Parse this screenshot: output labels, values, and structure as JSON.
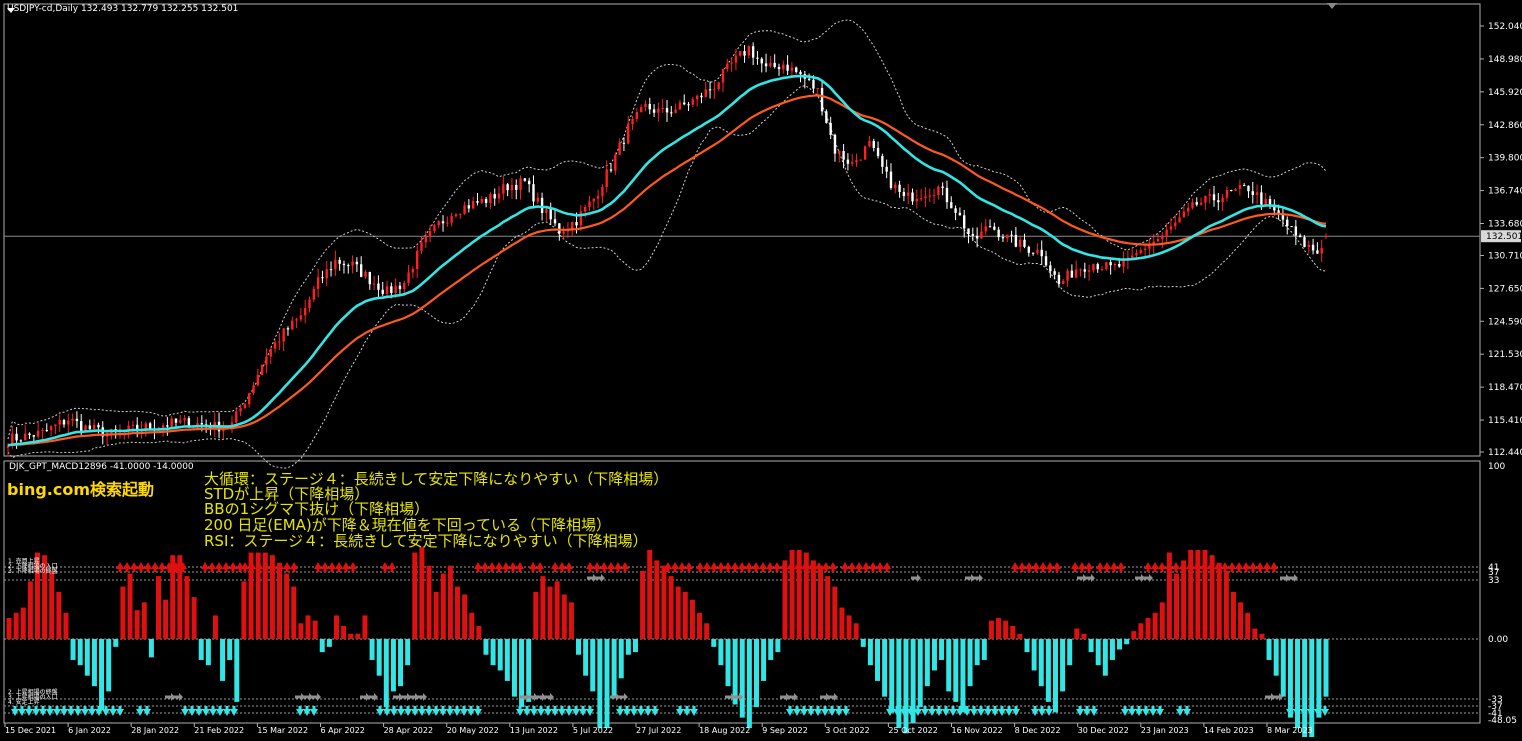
{
  "header": {
    "symbol_line": "USDJPY-cd,Daily  132.493 132.779 132.255 132.501",
    "indicator_line": "DJK_GPT_MACD12896 -41.0000 -14.0000"
  },
  "overlay": {
    "bing_label": "bing.com検索起動",
    "signals": [
      "大循環：ステージ４：長続きして安定下降になりやすい（下降相場）",
      "STDが上昇（下降相場）",
      "BBの1シグマ下抜け（下降相場）",
      "200 日足(EMA)が下降＆現在値を下回っている（下降相場）",
      "RSI：ステージ４：長続きして安定下降になりやすい（下降相場）"
    ],
    "upper_legend": [
      "1. 売買上昇",
      "2. 下降相場の入口",
      "3. 下降相場の終盤"
    ],
    "lower_legend": [
      "2. 上昇相場の終盤",
      "3. 上昇相場の入口",
      "4. 安定上昇"
    ]
  },
  "colors": {
    "background": "#000000",
    "bull_candle": "#ff2020",
    "bear_candle": "#ffffff",
    "ema_fast": "#33e6e6",
    "ema_slow": "#ff5a1e",
    "bollinger": "#d0d0d0",
    "hist_up": "#e01010",
    "hist_down": "#33e6e6",
    "arrow_up": "#e01010",
    "arrow_gray": "#909090",
    "axis_text": "#ffffff",
    "signal_text": "#e6e600",
    "bing_text": "#ffd800",
    "current_price_line": "#8a8a8a"
  },
  "chart_data": [
    {
      "type": "candlestick",
      "title": "USDJPY-cd,Daily",
      "last_ohlc": {
        "open": 132.493,
        "high": 132.779,
        "low": 132.255,
        "close": 132.501
      },
      "current_price": 132.501,
      "ylim": [
        112.44,
        152.04
      ],
      "y_ticks": [
        152.04,
        148.98,
        145.92,
        142.86,
        139.8,
        136.74,
        133.68,
        130.71,
        127.65,
        124.59,
        121.53,
        118.47,
        115.41,
        112.44
      ],
      "x_tick_labels": [
        "15 Dec 2021",
        "6 Jan 2022",
        "28 Jan 2022",
        "21 Feb 2022",
        "15 Mar 2022",
        "6 Apr 2022",
        "28 Apr 2022",
        "20 May 2022",
        "13 Jun 2022",
        "5 Jul 2022",
        "27 Jul 2022",
        "18 Aug 2022",
        "9 Sep 2022",
        "3 Oct 2022",
        "25 Oct 2022",
        "16 Nov 2022",
        "8 Dec 2022",
        "30 Dec 2022",
        "23 Jan 2023",
        "14 Feb 2023",
        "8 Mar 2023"
      ],
      "close_path": [
        [
          0,
          113.6
        ],
        [
          8,
          114.2
        ],
        [
          14,
          115.5
        ],
        [
          18,
          114.7
        ],
        [
          24,
          114.1
        ],
        [
          30,
          114.6
        ],
        [
          36,
          115.0
        ],
        [
          42,
          115.2
        ],
        [
          48,
          114.8
        ],
        [
          52,
          115.0
        ],
        [
          56,
          118.0
        ],
        [
          60,
          121.5
        ],
        [
          64,
          123.5
        ],
        [
          68,
          125.0
        ],
        [
          72,
          128.2
        ],
        [
          76,
          130.2
        ],
        [
          80,
          129.8
        ],
        [
          84,
          128.5
        ],
        [
          88,
          127.3
        ],
        [
          92,
          128.2
        ],
        [
          96,
          131.5
        ],
        [
          100,
          133.6
        ],
        [
          104,
          135.0
        ],
        [
          108,
          135.5
        ],
        [
          112,
          136.0
        ],
        [
          116,
          137.2
        ],
        [
          120,
          137.5
        ],
        [
          124,
          135.0
        ],
        [
          128,
          133.0
        ],
        [
          132,
          134.0
        ],
        [
          136,
          136.0
        ],
        [
          140,
          139.0
        ],
        [
          144,
          142.5
        ],
        [
          148,
          144.5
        ],
        [
          152,
          144.0
        ],
        [
          156,
          144.5
        ],
        [
          160,
          145.3
        ],
        [
          164,
          146.5
        ],
        [
          168,
          148.5
        ],
        [
          172,
          150.0
        ],
        [
          176,
          148.0
        ],
        [
          180,
          148.5
        ],
        [
          184,
          147.5
        ],
        [
          188,
          146.0
        ],
        [
          192,
          140.5
        ],
        [
          196,
          139.2
        ],
        [
          200,
          141.0
        ],
        [
          204,
          138.0
        ],
        [
          208,
          136.0
        ],
        [
          212,
          136.5
        ],
        [
          216,
          137.0
        ],
        [
          220,
          135.0
        ],
        [
          224,
          132.0
        ],
        [
          228,
          133.5
        ],
        [
          232,
          132.3
        ],
        [
          236,
          131.5
        ],
        [
          240,
          131.0
        ],
        [
          244,
          128.0
        ],
        [
          248,
          129.5
        ],
        [
          252,
          130.0
        ],
        [
          256,
          129.5
        ],
        [
          260,
          130.0
        ],
        [
          264,
          131.5
        ],
        [
          268,
          132.5
        ],
        [
          272,
          134.0
        ],
        [
          276,
          135.5
        ],
        [
          280,
          136.0
        ],
        [
          284,
          136.5
        ],
        [
          288,
          137.0
        ],
        [
          292,
          135.5
        ],
        [
          296,
          134.0
        ],
        [
          300,
          132.0
        ],
        [
          304,
          131.0
        ],
        [
          306,
          132.5
        ]
      ],
      "series": [
        {
          "name": "",
          "kind": "ema_fast",
          "period": 25
        },
        {
          "name": "",
          "kind": "ema_slow",
          "period": 45
        },
        {
          "name": "",
          "kind": "bollinger",
          "period": 20,
          "sigma": 2
        }
      ]
    },
    {
      "type": "bar",
      "title": "DJK_GPT_MACD12896",
      "ylim": [
        -48.05,
        100
      ],
      "y_ticks": [
        100,
        41,
        37,
        33,
        0.0,
        -33,
        -37,
        -41,
        -48.05
      ],
      "y_tick_labels": [
        "100",
        "41",
        "37",
        "33",
        "0.00",
        "-33",
        "-37",
        "-41",
        "-48.05"
      ],
      "values": [
        8,
        10,
        12,
        22,
        33,
        32,
        26,
        18,
        10,
        -8,
        -10,
        -14,
        -18,
        -27,
        -20,
        -3,
        20,
        25,
        11,
        14,
        -7,
        24,
        15,
        32,
        32,
        24,
        16,
        -8,
        -10,
        9,
        -16,
        -8,
        -24,
        22,
        33,
        33,
        33,
        32,
        29,
        25,
        20,
        6,
        9,
        7,
        -5,
        -3,
        9,
        5,
        2,
        2,
        9,
        -8,
        -14,
        -26,
        -20,
        -18,
        -10,
        33,
        35,
        28,
        18,
        25,
        28,
        20,
        17,
        10,
        5,
        -6,
        -10,
        -12,
        -16,
        -22,
        -26,
        -24,
        18,
        24,
        20,
        22,
        17,
        14,
        -6,
        -14,
        -20,
        -34,
        -34,
        -22,
        -15,
        -6,
        -5,
        26,
        34,
        30,
        28,
        24,
        20,
        18,
        15,
        10,
        6,
        -3,
        -10,
        -18,
        -25,
        -30,
        -34,
        -26,
        -16,
        -8,
        -5,
        30,
        34,
        34,
        33,
        30,
        28,
        24,
        20,
        12,
        9,
        6,
        -3,
        -10,
        -16,
        -22,
        -28,
        -34,
        -36,
        -32,
        -26,
        -18,
        -12,
        -8,
        -20,
        -24,
        -28,
        -18,
        -10,
        -8,
        7,
        8,
        7,
        5,
        2,
        -5,
        -12,
        -18,
        -24,
        -28,
        -20,
        -10,
        4,
        2,
        -5,
        -10,
        -14,
        -8,
        -4,
        -2,
        3,
        6,
        8,
        10,
        14,
        33,
        25,
        30,
        34,
        34,
        34,
        32,
        29,
        26,
        18,
        14,
        10,
        4,
        2,
        -8,
        -14,
        -22,
        -30,
        -34,
        -40,
        -38,
        -30,
        -22
      ],
      "signal_levels": [
        41,
        37,
        33,
        -33,
        -37,
        -41
      ],
      "up_arrow_run_count": 27,
      "down_arrow_run_count": 24
    }
  ]
}
